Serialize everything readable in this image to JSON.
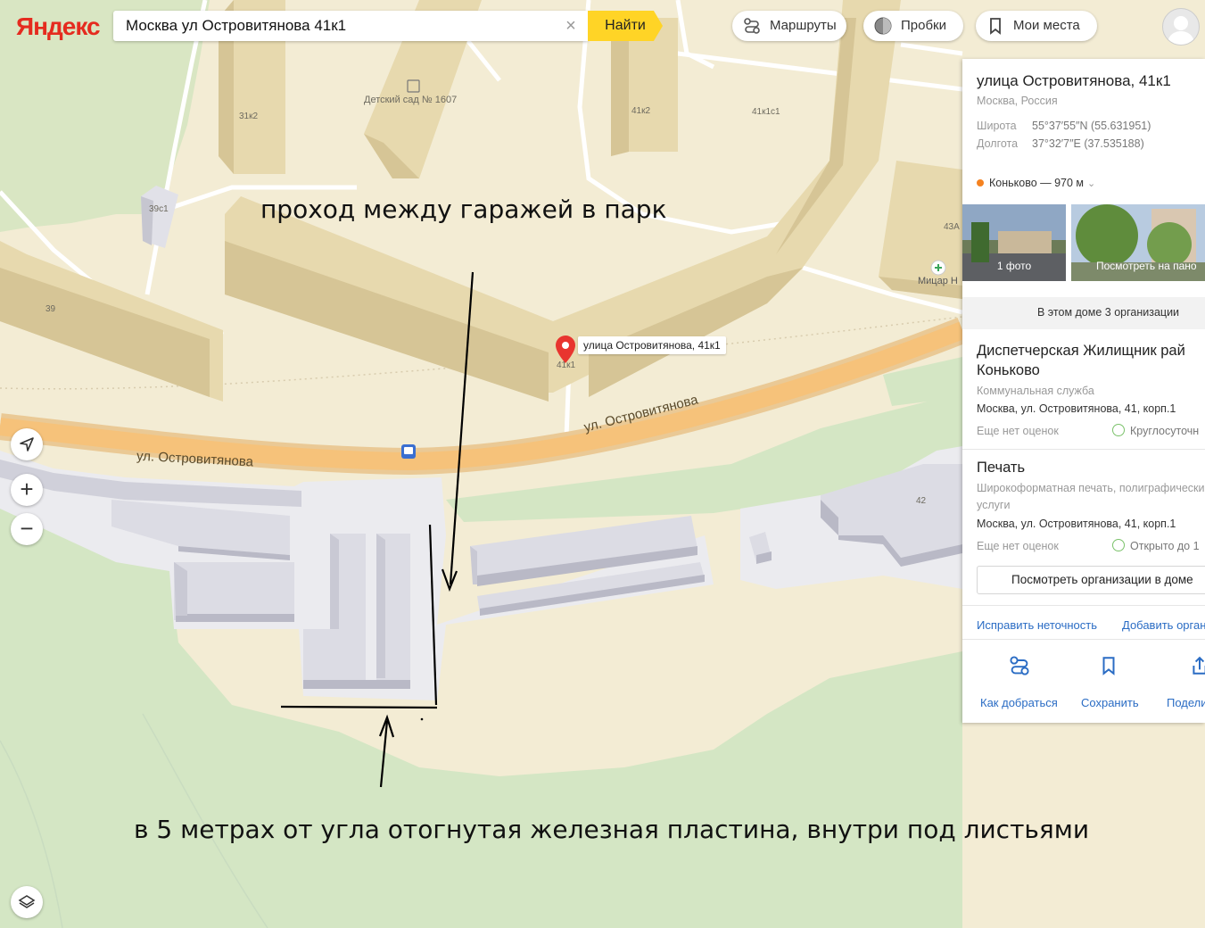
{
  "header": {
    "logo": "Яндекс",
    "search_value": "Москва ул Островитянова 41к1",
    "find_label": "Найти",
    "routes_label": "Маршруты",
    "traffic_label": "Пробки",
    "places_label": "Мои места"
  },
  "map": {
    "building_labels": [
      "31к2",
      "Детский сад № 1607",
      "41к2",
      "41к1с1",
      "39с1",
      "39",
      "43А",
      "42",
      "41к1"
    ],
    "road_labels": [
      "ул. Островитянова",
      "ул. Островитянова"
    ],
    "marker_label": "улица Островитянова, 41к1",
    "poi_label": "Мицар Н"
  },
  "annotations": {
    "top_text": "проход между гаражей в парк",
    "bottom_text": "в 5 метрах от угла отогнутая железная пластина, внутри под листьями"
  },
  "card": {
    "title": "улица Островитянова, 41к1",
    "subtitle": "Москва, Россия",
    "lat_label": "Широта",
    "lat_value": "55°37′55″N (55.631951)",
    "lon_label": "Долгота",
    "lon_value": "37°32′7″E (37.535188)",
    "metro": "Коньково — 970 м",
    "metro_color": "#f58220",
    "photo_label": "1 фото",
    "pano_label": "Посмотреть на пано",
    "orgs_header": "В этом доме 3 организации",
    "orgs": [
      {
        "name_line1": "Диспетчерская Жилищник рай",
        "name_line2": "Коньково",
        "category": "Коммунальная служба",
        "address": "Москва, ул. Островитянова, 41, корп.1",
        "rating": "Еще нет оценок",
        "hours": "Круглосуточн"
      },
      {
        "name_line1": "Печать",
        "category_line1": "Широкоформатная печать, полиграфически",
        "category_line2": "услуги",
        "address": "Москва, ул. Островитянова, 41, корп.1",
        "rating": "Еще нет оценок",
        "hours": "Открыто до 1"
      }
    ],
    "view_orgs_button": "Посмотреть организации в доме",
    "fix_link": "Исправить неточность",
    "add_link": "Добавить орган",
    "actions": {
      "route": "Как добраться",
      "save": "Сохранить",
      "share": "Подели"
    }
  }
}
